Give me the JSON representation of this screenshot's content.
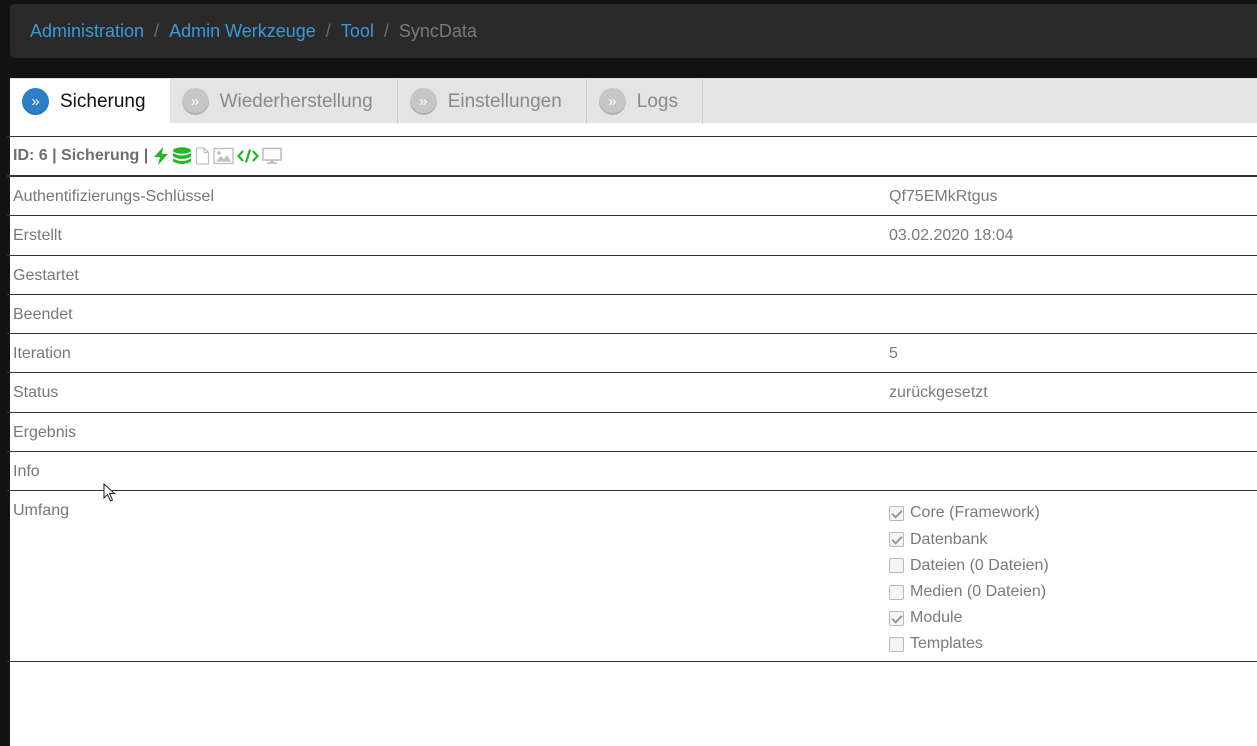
{
  "breadcrumb": {
    "items": [
      "Administration",
      "Admin Werkzeuge",
      "Tool"
    ],
    "current": "SyncData",
    "separator": "/"
  },
  "tabs": [
    {
      "label": "Sicherung",
      "bullet": "»",
      "active": true
    },
    {
      "label": "Wiederherstellung",
      "bullet": "»",
      "active": false
    },
    {
      "label": "Einstellungen",
      "bullet": "»",
      "active": false
    },
    {
      "label": "Logs",
      "bullet": "»",
      "active": false
    }
  ],
  "header": {
    "title": "ID: 6 | Sicherung |",
    "icons": [
      "bolt-icon",
      "database-icon",
      "file-icon",
      "image-icon",
      "code-icon",
      "monitor-icon"
    ],
    "active_color": "#22b822",
    "inactive_color": "#c0c0c0"
  },
  "rows": [
    {
      "label": "Authentifizierungs-Schlüssel",
      "value": "Qf75EMkRtgus"
    },
    {
      "label": "Erstellt",
      "value": "03.02.2020 18:04"
    },
    {
      "label": "Gestartet",
      "value": ""
    },
    {
      "label": "Beendet",
      "value": ""
    },
    {
      "label": "Iteration",
      "value": "5"
    },
    {
      "label": "Status",
      "value": "zurückgesetzt"
    },
    {
      "label": "Ergebnis",
      "value": ""
    },
    {
      "label": "Info",
      "value": ""
    }
  ],
  "scope": {
    "label": "Umfang",
    "items": [
      {
        "label": "Core (Framework)",
        "checked": true
      },
      {
        "label": "Datenbank",
        "checked": true
      },
      {
        "label": "Dateien (0 Dateien)",
        "checked": false
      },
      {
        "label": "Medien (0 Dateien)",
        "checked": false
      },
      {
        "label": "Module",
        "checked": true
      },
      {
        "label": "Templates",
        "checked": false
      }
    ]
  },
  "colors": {
    "link": "#3a9ad9",
    "active_tab_bullet": "#2c7fc6"
  }
}
